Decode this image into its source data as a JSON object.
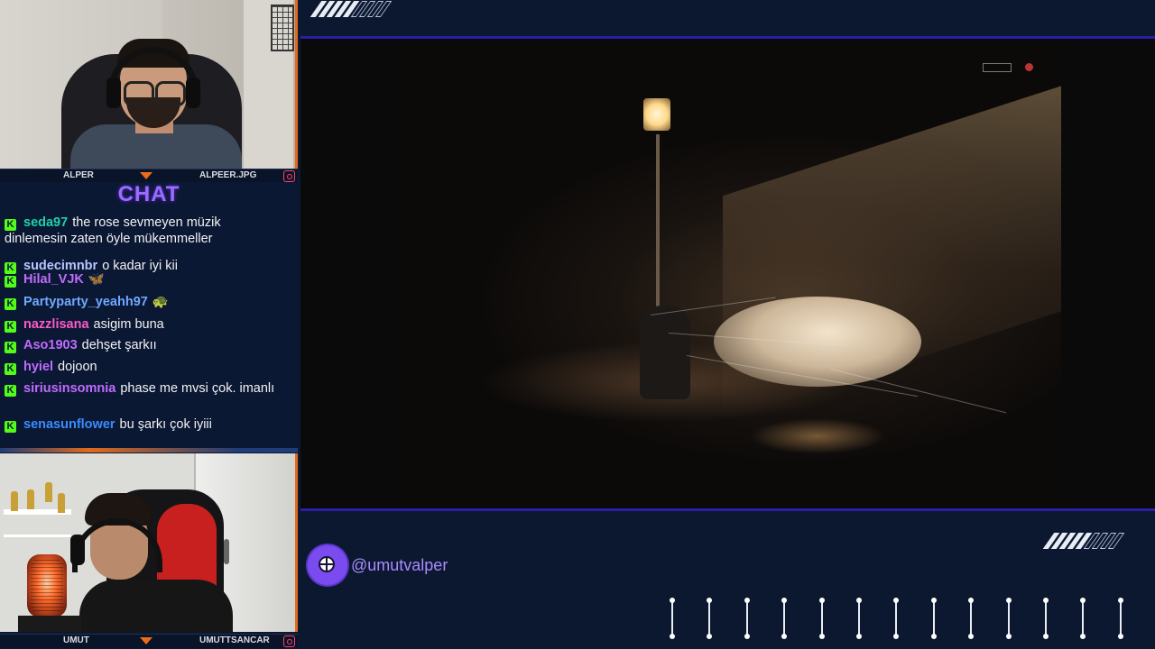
{
  "cams": {
    "top": {
      "left_name": "ALPER",
      "right_name": "ALPEER.JPG"
    },
    "bottom": {
      "left_name": "UMUT",
      "right_name": "UMUTTSANCAR"
    }
  },
  "chat": {
    "title": "CHAT",
    "badge_glyph": "K",
    "messages": [
      {
        "user": "seda97",
        "color": "#1fd1a6",
        "text": "the rose sevmeyen müzik dinlemesin zaten öyle mükemmeller",
        "emote": ""
      },
      {
        "user": "sudecimnbr",
        "color": "#b7c6ff",
        "text": "o kadar iyi kii",
        "emote": ""
      },
      {
        "user": "Hilal_VJK",
        "color": "#c06bff",
        "text": "",
        "emote": "🦋"
      },
      {
        "user": "Partyparty_yeahh97",
        "color": "#6fa8ff",
        "text": "",
        "emote": "🐢"
      },
      {
        "user": "nazzlisana",
        "color": "#ff5ac8",
        "text": "asigim buna",
        "emote": ""
      },
      {
        "user": "Aso1903",
        "color": "#c06bff",
        "text": "dehşet şarkıı",
        "emote": ""
      },
      {
        "user": "hyiel",
        "color": "#c06bff",
        "text": "dojoon",
        "emote": ""
      },
      {
        "user": "siriusinsomnia",
        "color": "#c06bff",
        "text": "phase me mvsi çok. imanlı",
        "emote": ""
      },
      {
        "user": "senasunflower",
        "color": "#3a8cff",
        "text": "bu şarkı çok iyiii",
        "emote": ""
      }
    ]
  },
  "social": {
    "icon": "globe-icon",
    "handle": "@umutvalper"
  },
  "colors": {
    "accent_purple": "#7a4cf0",
    "accent_orange": "#e06a1b",
    "kick_green": "#53fc18"
  }
}
